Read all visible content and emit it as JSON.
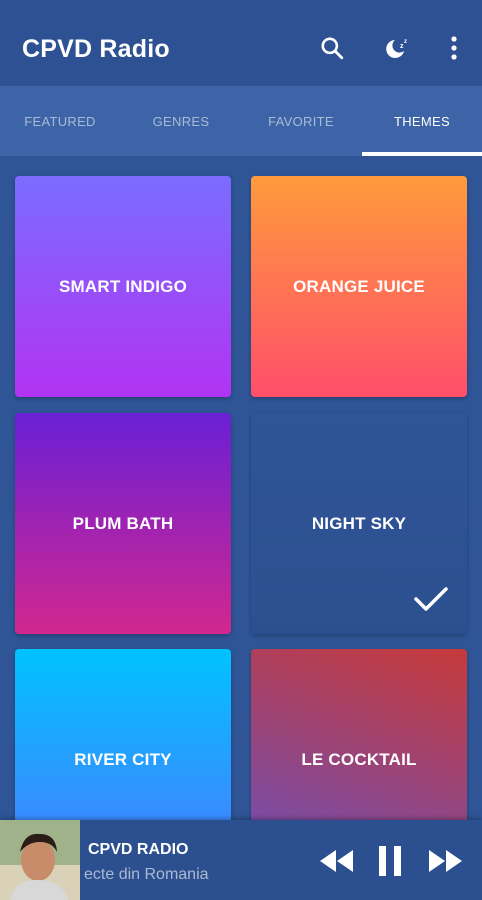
{
  "app": {
    "title": "CPVD Radio"
  },
  "toolbar": {
    "icons": [
      "search-icon",
      "sleep-timer-icon",
      "more-vert-icon"
    ]
  },
  "tabs": [
    {
      "label": "FEATURED",
      "active": false
    },
    {
      "label": "GENRES",
      "active": false
    },
    {
      "label": "FAVORITE",
      "active": false
    },
    {
      "label": "THEMES",
      "active": true
    }
  ],
  "themes": [
    {
      "name": "SMART INDIGO",
      "colors": [
        "#7b6cff",
        "#b233f2"
      ],
      "selected": false
    },
    {
      "name": "ORANGE JUICE",
      "colors": [
        "#ff9a3c",
        "#ff4f6a"
      ],
      "selected": false
    },
    {
      "name": "PLUM BATH",
      "colors": [
        "#6a1fd6",
        "#d2278f"
      ],
      "selected": false
    },
    {
      "name": "NIGHT SKY",
      "colors": [
        "#2f5597",
        "#2c4f8f"
      ],
      "selected": true
    },
    {
      "name": "RIVER CITY",
      "colors": [
        "#00c2ff",
        "#4a7cff"
      ],
      "selected": false
    },
    {
      "name": "LE COCKTAIL",
      "colors": [
        "#c73a3a",
        "#6c4fb8"
      ],
      "selected": false
    }
  ],
  "player": {
    "station": "CPVD RADIO",
    "subtitle": "ecte din Romania",
    "controls": [
      "rewind-icon",
      "pause-icon",
      "fast-forward-icon"
    ]
  }
}
